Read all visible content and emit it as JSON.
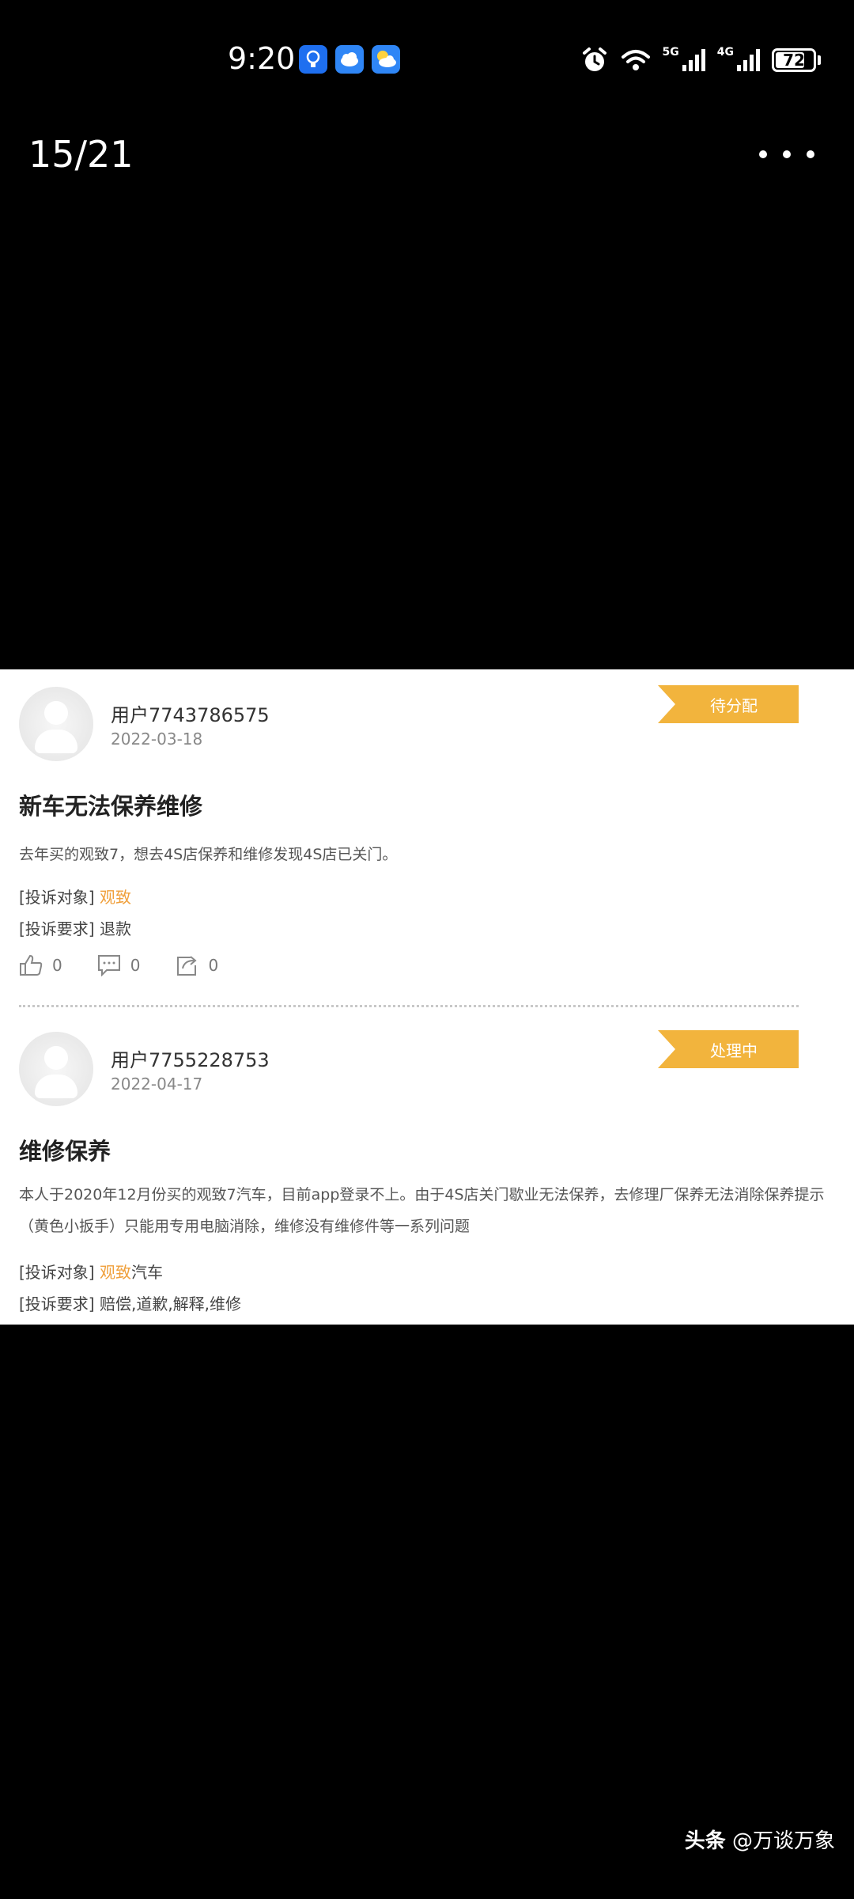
{
  "status_bar": {
    "time": "9:20",
    "battery": "72",
    "signal_label_1": "5G",
    "signal_label_2": "4G"
  },
  "viewer": {
    "counter": "15/21"
  },
  "posts": [
    {
      "username": "用户7743786575",
      "date": "2022-03-18",
      "status": "待分配",
      "title": "新车无法保养维修",
      "body": "去年买的观致7，想去4S店保养和维修发现4S店已关门。",
      "target_label": "[投诉对象]",
      "target_link": "观致",
      "target_suffix": "",
      "request_label": "[投诉要求]",
      "request_value": "退款",
      "likes": "0",
      "comments": "0",
      "shares": "0"
    },
    {
      "username": "用户7755228753",
      "date": "2022-04-17",
      "status": "处理中",
      "title": "维修保养",
      "body": "本人于2020年12月份买的观致7汽车，目前app登录不上。由于4S店关门歇业无法保养，去修理厂保养无法消除保养提示（黄色小扳手）只能用专用电脑消除，维修没有维修件等一系列问题",
      "target_label": "[投诉对象]",
      "target_link": "观致",
      "target_suffix": "汽车",
      "request_label": "[投诉要求]",
      "request_value": "赔偿,道歉,解释,维修"
    }
  ],
  "watermark": {
    "brand": "头条",
    "handle": "@万谈万象"
  },
  "colors": {
    "status_tag": "#f2b43d",
    "link": "#f0a03c",
    "background": "#000000"
  }
}
